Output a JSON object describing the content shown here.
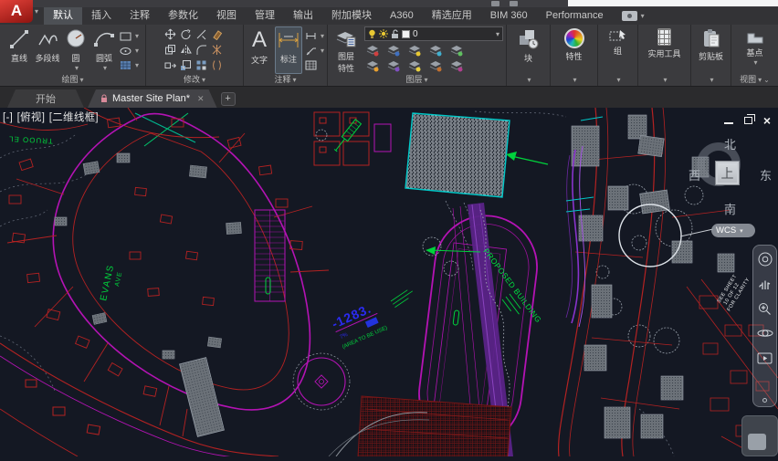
{
  "app": {
    "logo_letter": "A"
  },
  "colors": {
    "canvas_bg": "#141823",
    "magenta": "#b413b4",
    "red": "#b42222",
    "green": "#00d23c",
    "cyan": "#00c8c8",
    "blue": "#2b2bf0",
    "purple": "#7a2fa8",
    "active_tab": "#4d5055"
  },
  "ribbon_tabs": [
    {
      "label": "默认",
      "active": true
    },
    {
      "label": "插入"
    },
    {
      "label": "注释"
    },
    {
      "label": "参数化"
    },
    {
      "label": "视图"
    },
    {
      "label": "管理"
    },
    {
      "label": "输出"
    },
    {
      "label": "附加模块"
    },
    {
      "label": "A360"
    },
    {
      "label": "精选应用"
    },
    {
      "label": "BIM 360"
    },
    {
      "label": "Performance"
    }
  ],
  "ribbon": {
    "draw": {
      "panel_label": "绘图",
      "buttons": [
        {
          "label": "直线"
        },
        {
          "label": "多段线"
        },
        {
          "label": "圆"
        },
        {
          "label": "圆弧"
        }
      ]
    },
    "modify": {
      "panel_label": "修改"
    },
    "annotate": {
      "panel_label": "注释",
      "text_button": "文字",
      "dim_button": "标注"
    },
    "layers": {
      "panel_label": "图层",
      "properties_line1": "图层",
      "properties_line2": "特性",
      "current_layer": "0"
    },
    "block": {
      "label": "块"
    },
    "properties": {
      "label": "特性"
    },
    "group": {
      "label": "组"
    },
    "utilities": {
      "label": "实用工具"
    },
    "clipboard": {
      "label": "剪贴板"
    },
    "base": {
      "label": "基点"
    },
    "view": {
      "panel_label": "视图"
    }
  },
  "doc_tabs": {
    "start_tab": "开始",
    "active_tab": "Master Site Plan*"
  },
  "viewport_controls": {
    "menu": "[-]",
    "view": "[俯视]",
    "style": "[二维线框]"
  },
  "viewcube": {
    "north": "北",
    "south": "南",
    "west": "西",
    "east": "东",
    "top": "上",
    "wcs": "WCS"
  },
  "canvas_labels": {
    "proposed_building": "PROPOSED BUILDING",
    "elevation": "-1283.",
    "elevation_sub": "7%",
    "area_note": "(AREA TO BE USE)",
    "street_left": "EVANS",
    "street_left_2": "AVE",
    "street_top": "TRUOO EL",
    "sheet_note_1": "SEE SHEET",
    "sheet_note_2": "10 OF 12",
    "sheet_note_3": "FOR CLARITY"
  }
}
